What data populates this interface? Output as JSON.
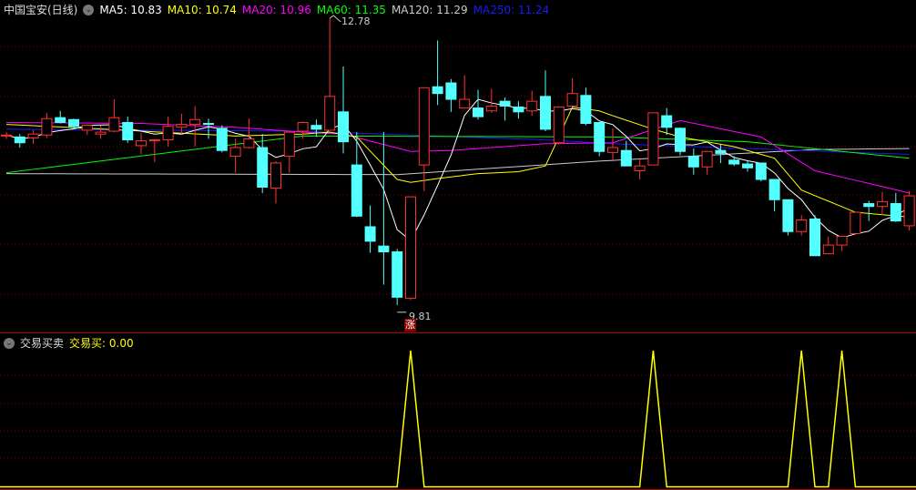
{
  "header": {
    "title": "中国宝安(日线)",
    "ma": [
      {
        "label": "MA5: 10.83",
        "color": "#ffffff"
      },
      {
        "label": "MA10: 10.74",
        "color": "#ffff00"
      },
      {
        "label": "MA20: 10.96",
        "color": "#ff00ff"
      },
      {
        "label": "MA60: 11.35",
        "color": "#00ff00"
      },
      {
        "label": "MA120: 11.29",
        "color": "#cccccc"
      },
      {
        "label": "MA250: 11.24",
        "color": "#1a1aff"
      }
    ]
  },
  "indicator": {
    "name": "交易买卖",
    "value_label": "交易买: 0.00",
    "color": "#ffff00"
  },
  "markers": {
    "high_label": "12.78",
    "low_label": "9.81",
    "badge": "涨"
  },
  "colors": {
    "up": "#ff3232",
    "down": "#54ffff",
    "grid": "#800000"
  },
  "chart_data": [
    {
      "type": "candlestick",
      "title": "中国宝安(日线)",
      "ylim": [
        9.81,
        12.78
      ],
      "ohlc": [
        [
          11.56,
          11.6,
          11.53,
          11.57
        ],
        [
          11.55,
          11.58,
          11.44,
          11.49
        ],
        [
          11.54,
          11.62,
          11.48,
          11.58
        ],
        [
          11.57,
          11.8,
          11.54,
          11.74
        ],
        [
          11.75,
          11.82,
          11.69,
          11.7
        ],
        [
          11.73,
          11.74,
          11.63,
          11.66
        ],
        [
          11.62,
          11.68,
          11.57,
          11.67
        ],
        [
          11.58,
          11.67,
          11.53,
          11.6
        ],
        [
          11.61,
          11.94,
          11.6,
          11.75
        ],
        [
          11.7,
          11.76,
          11.49,
          11.52
        ],
        [
          11.46,
          11.59,
          11.37,
          11.51
        ],
        [
          11.51,
          11.52,
          11.29,
          11.52
        ],
        [
          11.52,
          11.76,
          11.45,
          11.66
        ],
        [
          11.65,
          11.79,
          11.58,
          11.68
        ],
        [
          11.68,
          11.87,
          11.45,
          11.73
        ],
        [
          11.69,
          11.74,
          11.53,
          11.68
        ],
        [
          11.64,
          11.67,
          11.39,
          11.41
        ],
        [
          11.35,
          11.53,
          11.18,
          11.44
        ],
        [
          11.44,
          11.74,
          11.43,
          11.53
        ],
        [
          11.44,
          11.58,
          10.97,
          11.03
        ],
        [
          11.02,
          11.3,
          10.86,
          11.28
        ],
        [
          11.35,
          11.6,
          11.18,
          11.6
        ],
        [
          11.61,
          11.71,
          11.53,
          11.7
        ],
        [
          11.67,
          11.73,
          11.55,
          11.63
        ],
        [
          11.62,
          12.78,
          11.62,
          11.97
        ],
        [
          11.81,
          12.28,
          11.38,
          11.5
        ],
        [
          11.26,
          11.6,
          10.72,
          10.73
        ],
        [
          10.62,
          10.84,
          10.35,
          10.47
        ],
        [
          10.42,
          11.6,
          10.02,
          10.36
        ],
        [
          10.36,
          10.39,
          9.81,
          9.89
        ],
        [
          9.88,
          10.93,
          9.86,
          10.93
        ],
        [
          11.26,
          12.06,
          10.99,
          12.06
        ],
        [
          12.07,
          12.55,
          11.88,
          12.0
        ],
        [
          12.11,
          12.15,
          11.81,
          11.94
        ],
        [
          11.85,
          12.19,
          11.85,
          11.94
        ],
        [
          11.85,
          12.04,
          11.73,
          11.76
        ],
        [
          11.82,
          12.05,
          11.8,
          11.87
        ],
        [
          11.92,
          11.96,
          11.72,
          11.87
        ],
        [
          11.86,
          11.92,
          11.74,
          11.81
        ],
        [
          11.82,
          12.03,
          11.77,
          11.92
        ],
        [
          11.97,
          12.24,
          11.61,
          11.63
        ],
        [
          11.49,
          11.86,
          11.47,
          11.86
        ],
        [
          11.87,
          12.16,
          11.87,
          12.0
        ],
        [
          11.98,
          12.06,
          11.67,
          11.69
        ],
        [
          11.7,
          11.7,
          11.35,
          11.4
        ],
        [
          11.39,
          11.64,
          11.31,
          11.44
        ],
        [
          11.41,
          11.51,
          11.25,
          11.25
        ],
        [
          11.2,
          11.32,
          11.11,
          11.25
        ],
        [
          11.26,
          11.8,
          11.26,
          11.8
        ],
        [
          11.77,
          11.85,
          11.57,
          11.65
        ],
        [
          11.64,
          11.65,
          11.36,
          11.4
        ],
        [
          11.35,
          11.43,
          11.16,
          11.24
        ],
        [
          11.24,
          11.4,
          11.16,
          11.4
        ],
        [
          11.41,
          11.48,
          11.28,
          11.38
        ],
        [
          11.31,
          11.35,
          11.25,
          11.27
        ],
        [
          11.27,
          11.3,
          11.19,
          11.23
        ],
        [
          11.28,
          11.28,
          11.09,
          11.11
        ],
        [
          11.11,
          11.11,
          10.78,
          10.9
        ],
        [
          10.9,
          10.9,
          10.53,
          10.57
        ],
        [
          10.57,
          10.74,
          10.53,
          10.69
        ],
        [
          10.7,
          10.74,
          10.32,
          10.32
        ],
        [
          10.34,
          10.52,
          10.34,
          10.43
        ],
        [
          10.43,
          10.52,
          10.37,
          10.52
        ],
        [
          10.55,
          10.77,
          10.55,
          10.77
        ],
        [
          10.86,
          10.89,
          10.68,
          10.83
        ],
        [
          10.83,
          10.98,
          10.74,
          10.88
        ],
        [
          10.86,
          10.97,
          10.67,
          10.68
        ],
        [
          10.63,
          10.99,
          10.58,
          10.94
        ]
      ],
      "ma_lines": {
        "ma10": [
          [
            0,
            11.68
          ],
          [
            6,
            11.64
          ],
          [
            17,
            11.56
          ],
          [
            22,
            11.58
          ],
          [
            24,
            11.6
          ],
          [
            26,
            11.55
          ],
          [
            29,
            11.11
          ],
          [
            30,
            11.08
          ],
          [
            32,
            11.12
          ],
          [
            35,
            11.17
          ],
          [
            38,
            11.19
          ],
          [
            40,
            11.25
          ],
          [
            41,
            11.55
          ],
          [
            42,
            11.86
          ],
          [
            44,
            11.82
          ],
          [
            45,
            11.77
          ],
          [
            48,
            11.63
          ],
          [
            50,
            11.55
          ],
          [
            54,
            11.45
          ],
          [
            57,
            11.33
          ],
          [
            59,
            11.0
          ],
          [
            63,
            10.77
          ],
          [
            67,
            10.72
          ]
        ],
        "ma20": [
          [
            0,
            11.7
          ],
          [
            10,
            11.69
          ],
          [
            17,
            11.65
          ],
          [
            22,
            11.6
          ],
          [
            25,
            11.58
          ],
          [
            30,
            11.4
          ],
          [
            33,
            11.41
          ],
          [
            40,
            11.48
          ],
          [
            45,
            11.49
          ],
          [
            50,
            11.72
          ],
          [
            56,
            11.55
          ],
          [
            60,
            11.2
          ],
          [
            67,
            10.97
          ]
        ],
        "ma60": [
          [
            0,
            11.18
          ],
          [
            22,
            11.56
          ],
          [
            45,
            11.55
          ],
          [
            55,
            11.5
          ],
          [
            67,
            11.33
          ]
        ],
        "ma120": [
          [
            0,
            11.17
          ],
          [
            29,
            11.16
          ],
          [
            44,
            11.3
          ],
          [
            60,
            11.42
          ],
          [
            67,
            11.43
          ]
        ],
        "ma250": [
          [
            0,
            11.63
          ],
          [
            22,
            11.61
          ],
          [
            40,
            11.52
          ],
          [
            45,
            11.48
          ],
          [
            67,
            11.37
          ]
        ]
      }
    },
    {
      "type": "line",
      "title": "交易买卖",
      "ylim": [
        0,
        1
      ],
      "signal_indices": [
        30,
        48,
        59,
        62
      ],
      "values_description_note": "value 1 at signal indices, 0 elsewhere"
    }
  ]
}
